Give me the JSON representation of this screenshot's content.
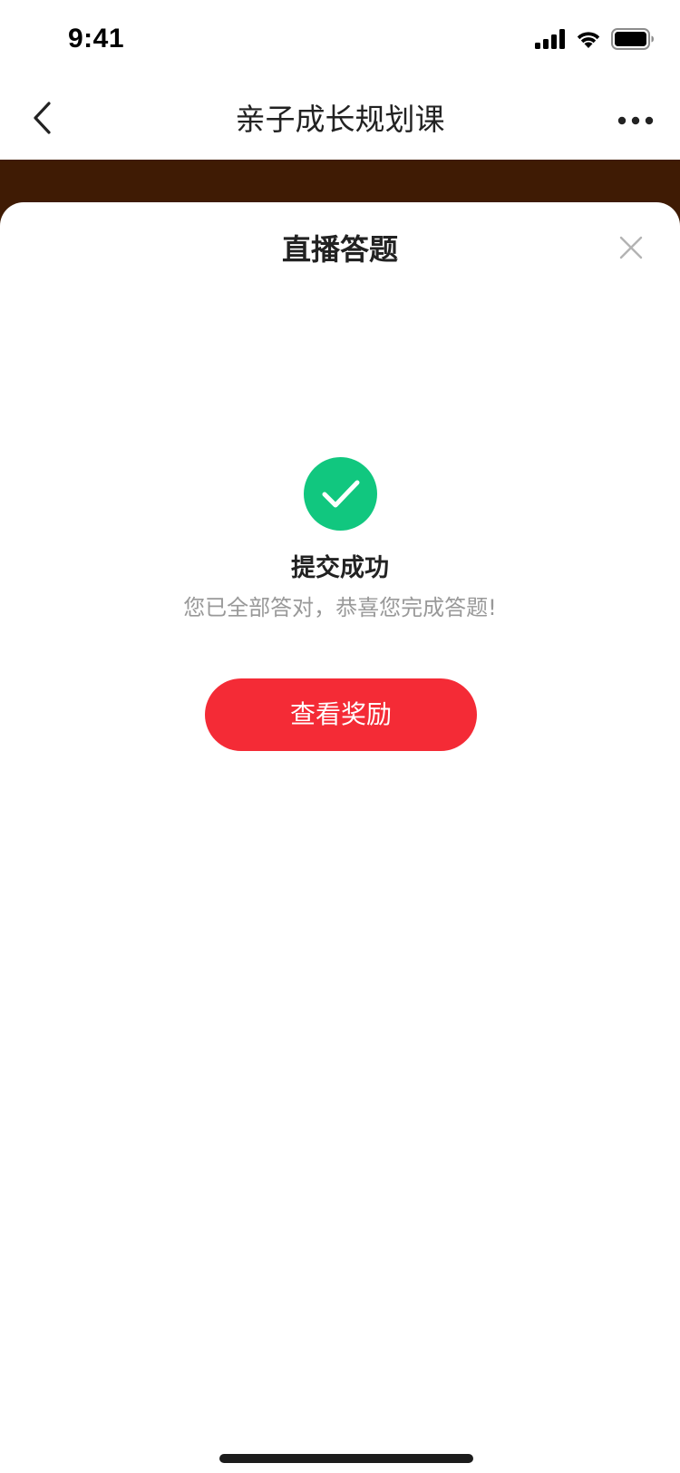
{
  "status_bar": {
    "time": "9:41",
    "signal_icon": "cellular-signal-icon",
    "wifi_icon": "wifi-icon",
    "battery_icon": "battery-icon"
  },
  "nav": {
    "back_icon": "chevron-left-icon",
    "title": "亲子成长规划课",
    "more_icon": "more-dots-icon"
  },
  "sheet": {
    "title": "直播答题",
    "close_icon": "close-icon",
    "success_icon": "check-circle-icon",
    "success_title": "提交成功",
    "success_desc": "您已全部答对，恭喜您完成答题!",
    "reward_button": "查看奖励"
  },
  "colors": {
    "accent_red": "#f42b36",
    "success_green": "#11c77f",
    "header_brown": "#3f1b04",
    "text_primary": "#222222",
    "text_secondary": "#999999"
  }
}
